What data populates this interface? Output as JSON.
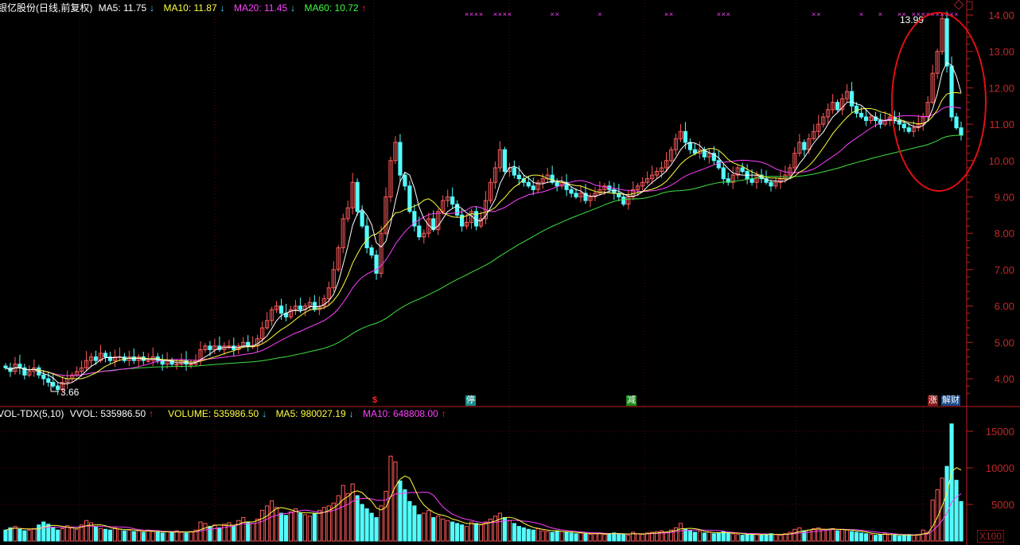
{
  "header": {
    "title": "银亿股份(日线,前复权)",
    "ma5": "MA5: 11.75",
    "ma10": "MA10: 11.87",
    "ma20": "MA20: 11.45",
    "ma60": "MA60: 10.72",
    "arrows": [
      "↓",
      "↓",
      "↓",
      "↑"
    ]
  },
  "volume_header": {
    "name": "VOL-TDX(5,10)",
    "vvol": "VVOL: 535986.50",
    "volume": "VOLUME: 535986.50",
    "ma5": "MA5: 980027.19",
    "ma10": "MA10: 648808.00",
    "arrows": [
      "↑",
      "↓",
      "↓",
      "↑"
    ]
  },
  "markers": {
    "dollar": "$",
    "halt": "停",
    "reduce": "减",
    "rise": "涨",
    "finance": "解财"
  },
  "unit_label": "X100",
  "colors": {
    "up": "#ff5a5a",
    "down": "#54fcfc",
    "ma5": "#ffffff",
    "ma10": "#ffff40",
    "ma20": "#ff40ff",
    "ma60": "#40e040",
    "axis": "#c02020"
  },
  "chart_data": {
    "type": "candlestick",
    "price_axis": {
      "min": 4,
      "max": 14,
      "ticks": [
        "14.00",
        "13.00",
        "12.00",
        "11.00",
        "10.00",
        "9.00",
        "8.00",
        "7.00",
        "6.00",
        "5.00",
        "4.00"
      ]
    },
    "volume_axis": {
      "min": 0,
      "max": 17000,
      "ticks": [
        "15000",
        "10000",
        "5000"
      ]
    },
    "annotations": {
      "high_label": "13.99",
      "low_label": "3.66"
    },
    "close": [
      4.3,
      4.2,
      4.4,
      4.3,
      4.1,
      4.2,
      4.3,
      4.1,
      4.0,
      3.9,
      3.8,
      3.7,
      3.9,
      4.0,
      4.1,
      4.2,
      4.3,
      4.5,
      4.6,
      4.5,
      4.7,
      4.6,
      4.5,
      4.6,
      4.6,
      4.5,
      4.6,
      4.5,
      4.6,
      4.5,
      4.5,
      4.6,
      4.5,
      4.4,
      4.5,
      4.4,
      4.4,
      4.5,
      4.4,
      4.4,
      4.5,
      4.8,
      4.9,
      4.8,
      4.9,
      4.8,
      4.9,
      4.9,
      4.8,
      4.9,
      5.0,
      4.9,
      4.9,
      5.1,
      5.4,
      5.6,
      5.9,
      6.0,
      5.8,
      5.7,
      5.9,
      6.0,
      5.9,
      6.0,
      6.1,
      5.9,
      6.0,
      6.2,
      6.5,
      7.0,
      7.6,
      8.4,
      8.7,
      9.4,
      8.6,
      8.2,
      7.6,
      7.4,
      6.9,
      8.0,
      9.0,
      10.0,
      10.5,
      9.6,
      9.3,
      8.6,
      8.2,
      7.9,
      8.0,
      8.4,
      8.1,
      8.6,
      8.9,
      9.0,
      8.8,
      8.5,
      8.2,
      8.3,
      8.6,
      8.2,
      8.4,
      8.9,
      9.4,
      9.8,
      10.3,
      9.7,
      9.8,
      9.6,
      9.5,
      9.4,
      9.3,
      9.2,
      9.4,
      9.5,
      9.6,
      9.4,
      9.3,
      9.4,
      9.2,
      9.1,
      9.0,
      9.1,
      8.9,
      9.0,
      9.1,
      9.2,
      9.3,
      9.2,
      9.1,
      9.0,
      8.8,
      9.0,
      9.2,
      9.3,
      9.4,
      9.5,
      9.6,
      9.7,
      9.8,
      10.0,
      10.3,
      10.6,
      10.8,
      10.5,
      10.3,
      10.2,
      10.3,
      10.1,
      10.2,
      10.0,
      9.8,
      9.5,
      9.4,
      9.6,
      9.8,
      9.7,
      9.5,
      9.4,
      9.6,
      9.5,
      9.4,
      9.3,
      9.4,
      9.5,
      9.6,
      9.8,
      10.2,
      10.5,
      10.3,
      10.6,
      10.8,
      11.0,
      11.2,
      11.4,
      11.6,
      11.4,
      11.7,
      11.9,
      11.5,
      11.3,
      11.2,
      11.1,
      11.2,
      11.1,
      11.0,
      11.1,
      11.2,
      11.1,
      11.0,
      10.9,
      10.8,
      10.9,
      11.0,
      11.2,
      11.6,
      12.4,
      13.0,
      13.9,
      12.6,
      11.2,
      10.9,
      10.7
    ],
    "volume": [
      1500,
      1800,
      2000,
      1600,
      1400,
      1500,
      1700,
      2200,
      2600,
      2300,
      1900,
      1500,
      1700,
      2100,
      1800,
      1600,
      2200,
      2800,
      2500,
      1900,
      1700,
      1600,
      1500,
      1800,
      1600,
      1400,
      1500,
      1300,
      1400,
      1200,
      1500,
      1300,
      1200,
      1100,
      1300,
      1200,
      1400,
      1200,
      1100,
      1300,
      1500,
      2600,
      2400,
      2000,
      2200,
      1800,
      2300,
      2500,
      2000,
      2800,
      3200,
      2600,
      2400,
      3000,
      4200,
      4800,
      5500,
      4600,
      3800,
      3500,
      4000,
      4400,
      3800,
      3600,
      3400,
      3800,
      4200,
      4600,
      4800,
      5200,
      6200,
      7600,
      6500,
      7800,
      6200,
      5000,
      4400,
      3800,
      3200,
      4800,
      6800,
      11600,
      10800,
      8200,
      7000,
      5400,
      4800,
      3600,
      3800,
      4200,
      3200,
      3400,
      3000,
      2800,
      2600,
      2400,
      2200,
      2000,
      2600,
      2400,
      2200,
      2600,
      3000,
      3400,
      3800,
      3200,
      2800,
      2400,
      2000,
      1800,
      1600,
      1500,
      1700,
      1400,
      1300,
      1200,
      1400,
      1300,
      1200,
      1100,
      1000,
      1100,
      1000,
      900,
      1000,
      1100,
      900,
      1000,
      1100,
      1000,
      900,
      800,
      1200,
      1000,
      900,
      1100,
      1200,
      1300,
      1400,
      1200,
      1500,
      1800,
      2400,
      1600,
      1400,
      1200,
      1300,
      1100,
      1200,
      1000,
      1100,
      1300,
      1100,
      1000,
      900,
      800,
      900,
      1000,
      900,
      800,
      900,
      1000,
      900,
      800,
      1000,
      1200,
      1600,
      1800,
      1400,
      1500,
      1700,
      1800,
      1600,
      1500,
      1700,
      1400,
      1600,
      1500,
      1300,
      1200,
      1100,
      1000,
      900,
      800,
      900,
      1000,
      900,
      800,
      700,
      800,
      900,
      800,
      900,
      1500,
      1200,
      5600,
      7000,
      8600,
      10200,
      16000,
      8300,
      5400
    ],
    "signal_mark_indices": [
      97,
      98,
      99,
      100,
      103,
      104,
      105,
      106,
      115,
      116,
      125,
      139,
      140,
      150,
      151,
      152,
      170,
      171,
      180,
      184,
      188,
      189,
      191,
      192,
      193,
      194,
      195,
      196,
      197,
      198,
      199,
      200
    ]
  }
}
